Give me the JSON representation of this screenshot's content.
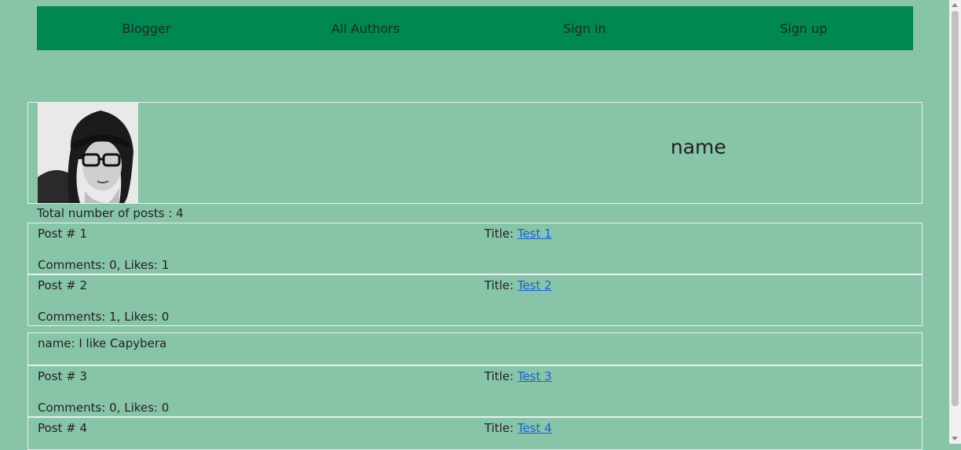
{
  "nav": {
    "items": [
      "Blogger",
      "All Authors",
      "Sign in",
      "Sign up"
    ]
  },
  "profile": {
    "name": "name"
  },
  "total_posts": "Total number of posts : 4",
  "posts": [
    {
      "num": "Post # 1",
      "title_label": "Title: ",
      "title_link": "Test 1",
      "meta": "Comments: 0, Likes: 1"
    },
    {
      "num": "Post # 2",
      "title_label": "Title: ",
      "title_link": "Test 2",
      "meta": "Comments: 1, Likes: 0"
    },
    {
      "num": "Post # 3",
      "title_label": "Title: ",
      "title_link": "Test 3",
      "meta": "Comments: 0, Likes: 0"
    },
    {
      "num": "Post # 4",
      "title_label": "Title: ",
      "title_link": "Test 4",
      "meta": ""
    }
  ],
  "comment": {
    "text": "name: I like Capybera"
  },
  "colors": {
    "background": "#88c4a8",
    "nav": "#008752",
    "link": "#1a5fd6"
  }
}
